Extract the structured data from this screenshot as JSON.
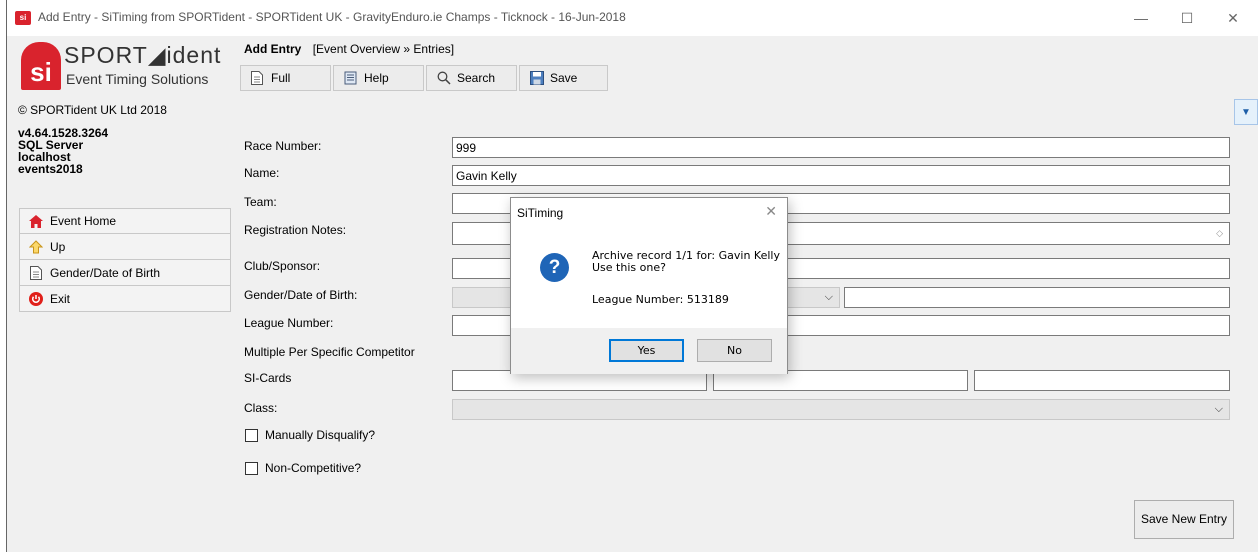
{
  "window": {
    "title": "Add Entry - SiTiming from SPORTident - SPORTident UK - GravityEnduro.ie Champs - Ticknock - 16-Jun-2018",
    "icon_text": "si",
    "minimize": "—",
    "maximize": "☐",
    "close": "✕"
  },
  "logo": {
    "mark": "si",
    "name": "SPORT◢ident",
    "subtitle": "Event Timing Solutions"
  },
  "info": {
    "copyright": "© SPORTident UK Ltd 2018",
    "version": "v4.64.1528.3264",
    "db_type": "SQL Server",
    "server": "localhost",
    "database": "events2018"
  },
  "nav": [
    {
      "label": "Event Home",
      "icon": "home-icon"
    },
    {
      "label": "Up",
      "icon": "up-arrow-icon"
    },
    {
      "label": "Gender/Date of Birth",
      "icon": "document-icon"
    },
    {
      "label": "Exit",
      "icon": "power-icon"
    }
  ],
  "header": {
    "title": "Add Entry",
    "breadcrumb": "[Event Overview » Entries]"
  },
  "toolbar": {
    "full": "Full",
    "help": "Help",
    "search": "Search",
    "save": "Save"
  },
  "form": {
    "race_number_label": "Race Number:",
    "race_number_value": "999",
    "name_label": "Name:",
    "name_value": "Gavin Kelly",
    "team_label": "Team:",
    "registration_notes_label": "Registration Notes:",
    "club_label": "Club/Sponsor:",
    "gender_dob_label": "Gender/Date of Birth:",
    "league_label": "League Number:",
    "multiple_label": "Multiple Per Specific Competitor",
    "sicards_label": "SI-Cards",
    "class_label": "Class:",
    "manual_dq_label": "Manually Disqualify?",
    "non_competitive_label": "Non-Competitive?",
    "save_new_entry": "Save New Entry"
  },
  "dialog": {
    "title": "SiTiming",
    "close": "✕",
    "message_line1": "Archive record 1/1 for: Gavin Kelly",
    "message_line2": "Use this one?",
    "league": "League Number: 513189",
    "yes": "Yes",
    "no": "No"
  }
}
